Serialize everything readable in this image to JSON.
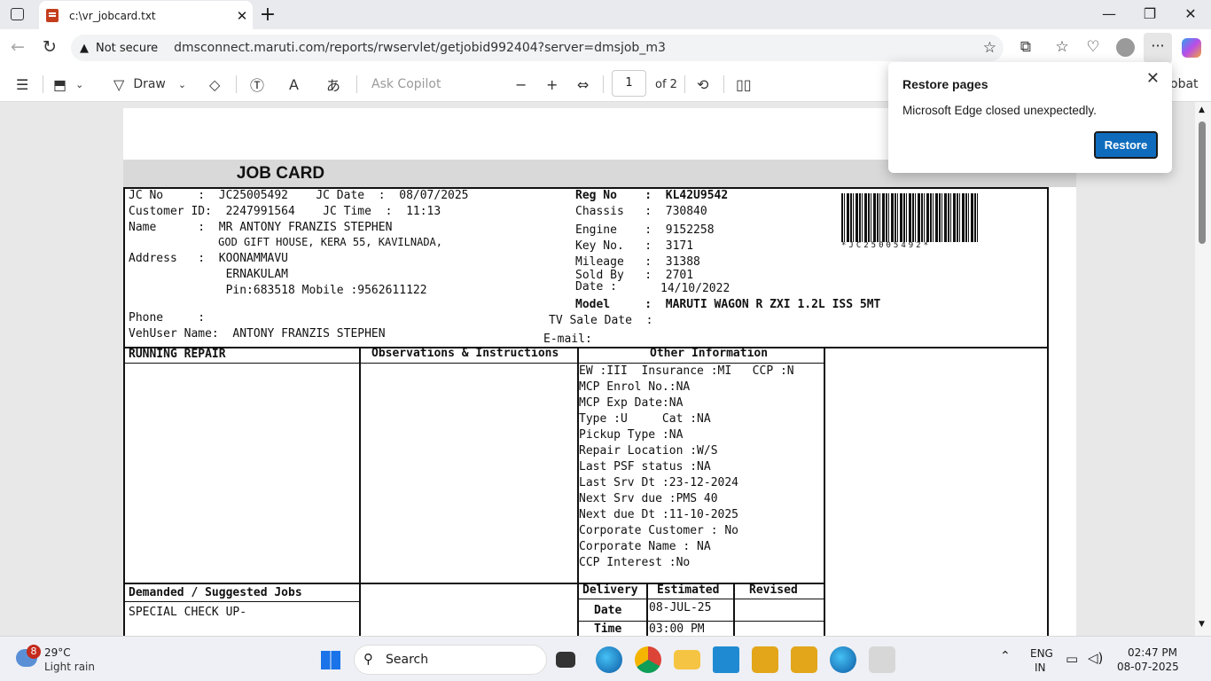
{
  "browser": {
    "tab_title": "c:\\vr_jobcard.txt",
    "security_label": "Not secure",
    "url": "dmsconnect.maruti.com/reports/rwservlet/getjobid992404?server=dmsjob_m3"
  },
  "pdf_toolbar": {
    "draw_label": "Draw",
    "ask_copilot": "Ask Copilot",
    "page_current": "1",
    "page_total": "of 2",
    "acrobat_label": "obat"
  },
  "popup": {
    "title": "Restore pages",
    "message": "Microsoft Edge closed unexpectedly.",
    "button": "Restore"
  },
  "jobcard": {
    "title": "JOB CARD",
    "l1": "JC No     :  JC25005492    JC Date  :  08/07/2025",
    "l2": "Customer ID:  2247991564    JC Time  :  11:13",
    "l3": "Name      :  MR ANTONY FRANZIS STEPHEN",
    "l4": "              GOD GIFT HOUSE, KERA 55, KAVILNADA,",
    "l5": "Address   :  KOONAMMAVU",
    "l6": "              ERNAKULAM",
    "l7": "              Pin:683518 Mobile :9562611122",
    "l8": "Phone     :",
    "l9": "VehUser Name:  ANTONY FRANZIS STEPHEN",
    "r1": "Reg No    :  KL42U9542",
    "r2": "Chassis   :  730840",
    "r3": "Engine    :  9152258",
    "r4": "Key No.   :  3171",
    "r5": "Mileage   :  31388",
    "r6": "Sold By   :  2701",
    "r7": "Date :",
    "r7v": "14/10/2022",
    "r8": "Model     :  MARUTI WAGON R ZXI 1.2L ISS 5MT",
    "r9": "TV Sale Date  :",
    "r10": "E-mail:",
    "barcode_text": "*JC25005492*",
    "h_running": "RUNNING REPAIR",
    "h_obs": "Observations & Instructions",
    "h_other": "Other Information",
    "other": [
      "EW :III  Insurance :MI   CCP :N",
      "MCP Enrol No.:NA",
      "MCP Exp Date:NA",
      "Type :U     Cat :NA",
      "Pickup Type :NA",
      "Repair Location :W/S",
      "Last PSF status :NA",
      "Last Srv Dt :23-12-2024",
      "Next Srv due :PMS 40",
      "Next due Dt :11-10-2025",
      "Corporate Customer : No",
      "Corporate Name : NA",
      "CCP Interest :No"
    ],
    "h_demanded": "Demanded / Suggested Jobs",
    "demanded1": "SPECIAL CHECK UP-",
    "h_delivery": "Delivery",
    "h_estimated": "Estimated",
    "h_revised": "Revised",
    "date_label": "Date",
    "date_value": "08-JUL-25",
    "time_label": "Time",
    "time_value": "03:00 PM"
  },
  "taskbar": {
    "weather_temp": "29°C",
    "weather_desc": "Light rain",
    "weather_badge": "8",
    "search": "Search",
    "lang1": "ENG",
    "lang2": "IN",
    "time": "02:47 PM",
    "date": "08-07-2025"
  }
}
